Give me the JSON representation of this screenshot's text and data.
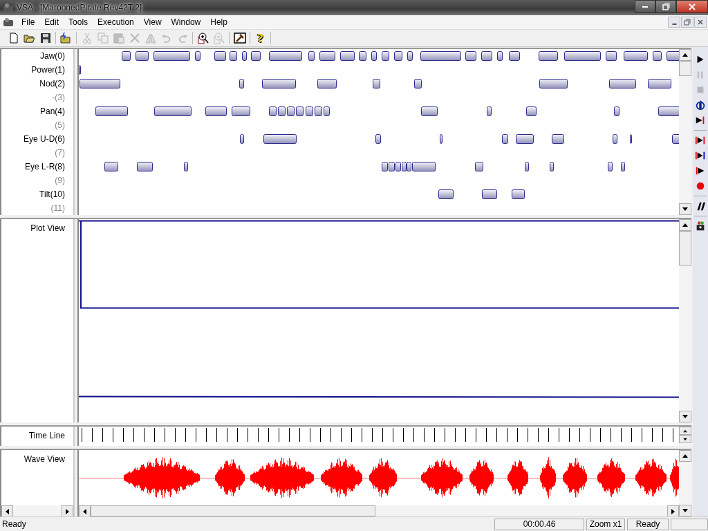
{
  "window": {
    "title": "VSA - [MaroonedPirate Rev42T 2]"
  },
  "menu": [
    "File",
    "Edit",
    "Tools",
    "Execution",
    "View",
    "Window",
    "Help"
  ],
  "toolbar": [
    {
      "disabled": false
    },
    {
      "disabled": false
    },
    {
      "disabled": false
    },
    {
      "disabled": false
    },
    {
      "disabled": true
    },
    {
      "disabled": true
    },
    {
      "disabled": true
    },
    {
      "disabled": true
    },
    {
      "disabled": true
    },
    {
      "disabled": true
    },
    {
      "disabled": true
    },
    {
      "disabled": false
    },
    {
      "disabled": true
    },
    {
      "disabled": false
    }
  ],
  "help_button": {
    "label": "?"
  },
  "channels": [
    {
      "label": "Jaw(0)",
      "active": true
    },
    {
      "label": "Power(1)",
      "active": true
    },
    {
      "label": "Nod(2)",
      "active": true
    },
    {
      "label": "-(3)",
      "active": false
    },
    {
      "label": "Pan(4)",
      "active": true
    },
    {
      "label": "(5)",
      "active": false
    },
    {
      "label": "Eye U-D(6)",
      "active": true
    },
    {
      "label": "(7)",
      "active": false
    },
    {
      "label": "Eye L-R(8)",
      "active": true
    },
    {
      "label": "(9)",
      "active": false
    },
    {
      "label": "Tilt(10)",
      "active": true
    },
    {
      "label": "(11)",
      "active": false
    }
  ],
  "plot_view": {
    "label": "Plot View"
  },
  "time_line": {
    "label": "Time Line"
  },
  "wave_view": {
    "label": "Wave View"
  },
  "transport": [
    {
      "disabled": false
    },
    {
      "disabled": true
    },
    {
      "disabled": true
    },
    {
      "disabled": false
    },
    {
      "disabled": false
    },
    {
      "disabled": false
    },
    {
      "disabled": false
    },
    {
      "disabled": false
    },
    {
      "disabled": false
    },
    {
      "disabled": false
    },
    {
      "disabled": false
    }
  ],
  "status_bar": {
    "message": "Ready",
    "time": "00:00.46",
    "zoom": "Zoom x1",
    "state": "Ready"
  }
}
